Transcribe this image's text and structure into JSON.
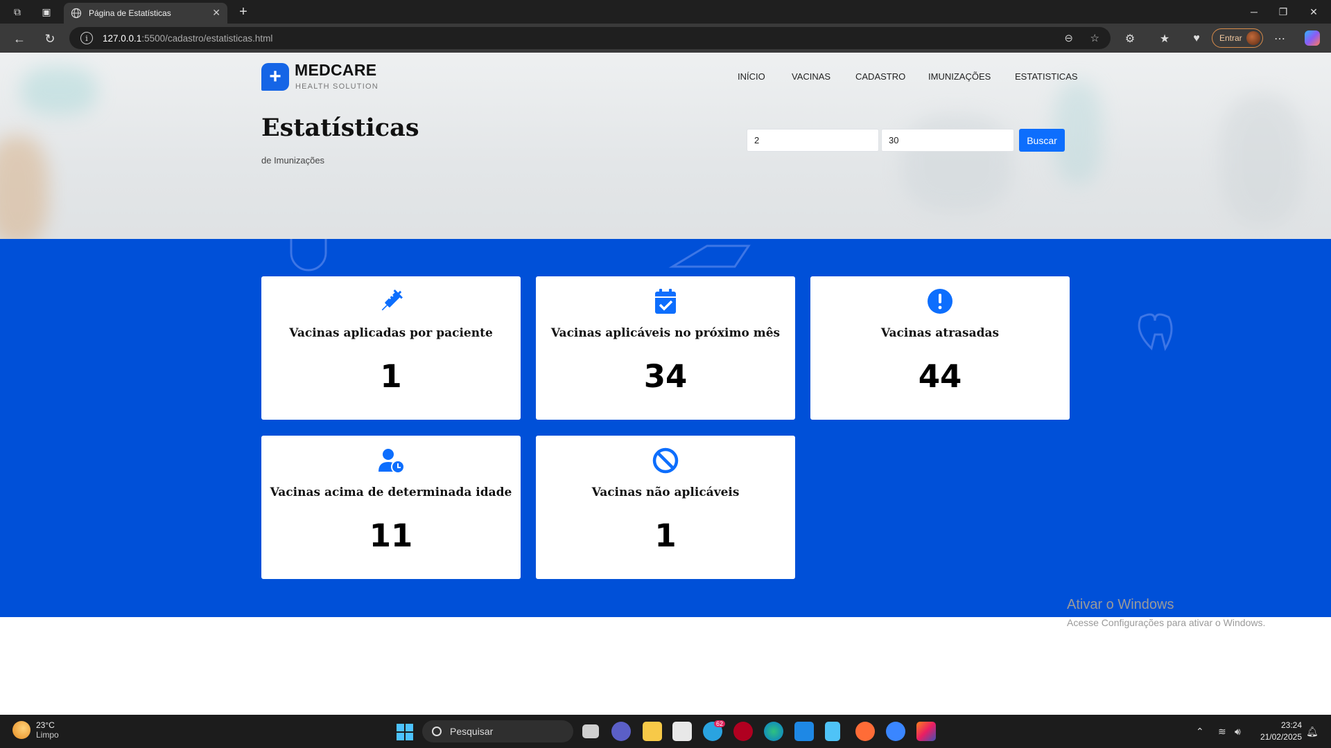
{
  "browser": {
    "tab_title": "Página de Estatísticas",
    "url_host": "127.0.0.1",
    "url_path": ":5500/cadastro/estatisticas.html",
    "signin_label": "Entrar"
  },
  "site": {
    "brand": "MEDCARE",
    "brand_sub": "HEALTH SOLUTION",
    "nav": [
      "INÍCIO",
      "VACINAS",
      "CADASTRO",
      "IMUNIZAÇÕES",
      "ESTATISTICAS"
    ],
    "title": "Estatísticas",
    "subtitle": "de Imunizações",
    "filter": {
      "value1": "2",
      "value2": "30",
      "button": "Buscar"
    },
    "accent_color": "#0050d8",
    "button_color": "#0d6efd"
  },
  "cards": [
    {
      "icon": "syringe-icon",
      "title": "Vacinas aplicadas por paciente",
      "value": "1"
    },
    {
      "icon": "calendar-check-icon",
      "title": "Vacinas aplicáveis no próximo mês",
      "value": "34"
    },
    {
      "icon": "exclamation-circle-icon",
      "title": "Vacinas atrasadas",
      "value": "44"
    },
    {
      "icon": "user-clock-icon",
      "title": "Vacinas acima de determinada idade",
      "value": "11"
    },
    {
      "icon": "ban-icon",
      "title": "Vacinas não aplicáveis",
      "value": "1"
    }
  ],
  "watermark": {
    "line1": "Ativar o Windows",
    "line2": "Acesse Configurações para ativar o Windows."
  },
  "taskbar": {
    "temp": "23°C",
    "weather": "Limpo",
    "search": "Pesquisar",
    "time": "23:24",
    "date": "21/02/2025",
    "badge": "62"
  }
}
